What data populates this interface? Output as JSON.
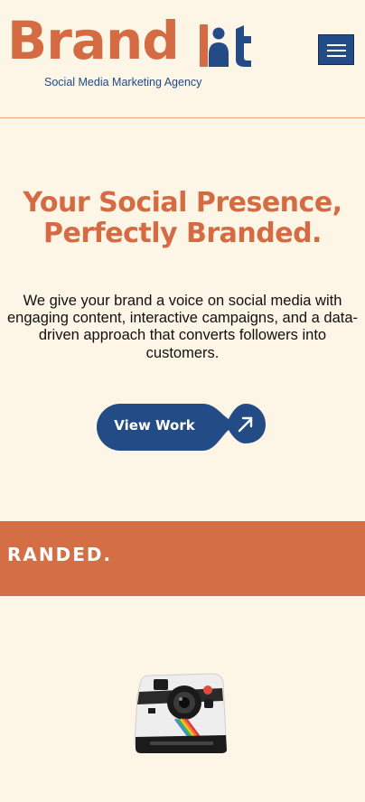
{
  "header": {
    "logo_text": "Brand",
    "tagline": "Social Media Marketing Agency",
    "menu_label": "Menu"
  },
  "hero": {
    "title_line1": "Your Social Presence,",
    "title_line2": "Perfectly Branded.",
    "description": "We give your brand a voice on social media with engaging content, interactive campaigns, and a data-driven approach that converts followers into customers.",
    "cta_label": "View Work"
  },
  "banner": {
    "text": "RANDED."
  },
  "colors": {
    "background": "#fdf5e6",
    "brand_orange": "#d46b43",
    "brand_navy": "#234b85"
  },
  "icons": [
    "logo-mark-icon",
    "hamburger-icon",
    "arrow-up-right-icon",
    "instant-camera-icon"
  ]
}
